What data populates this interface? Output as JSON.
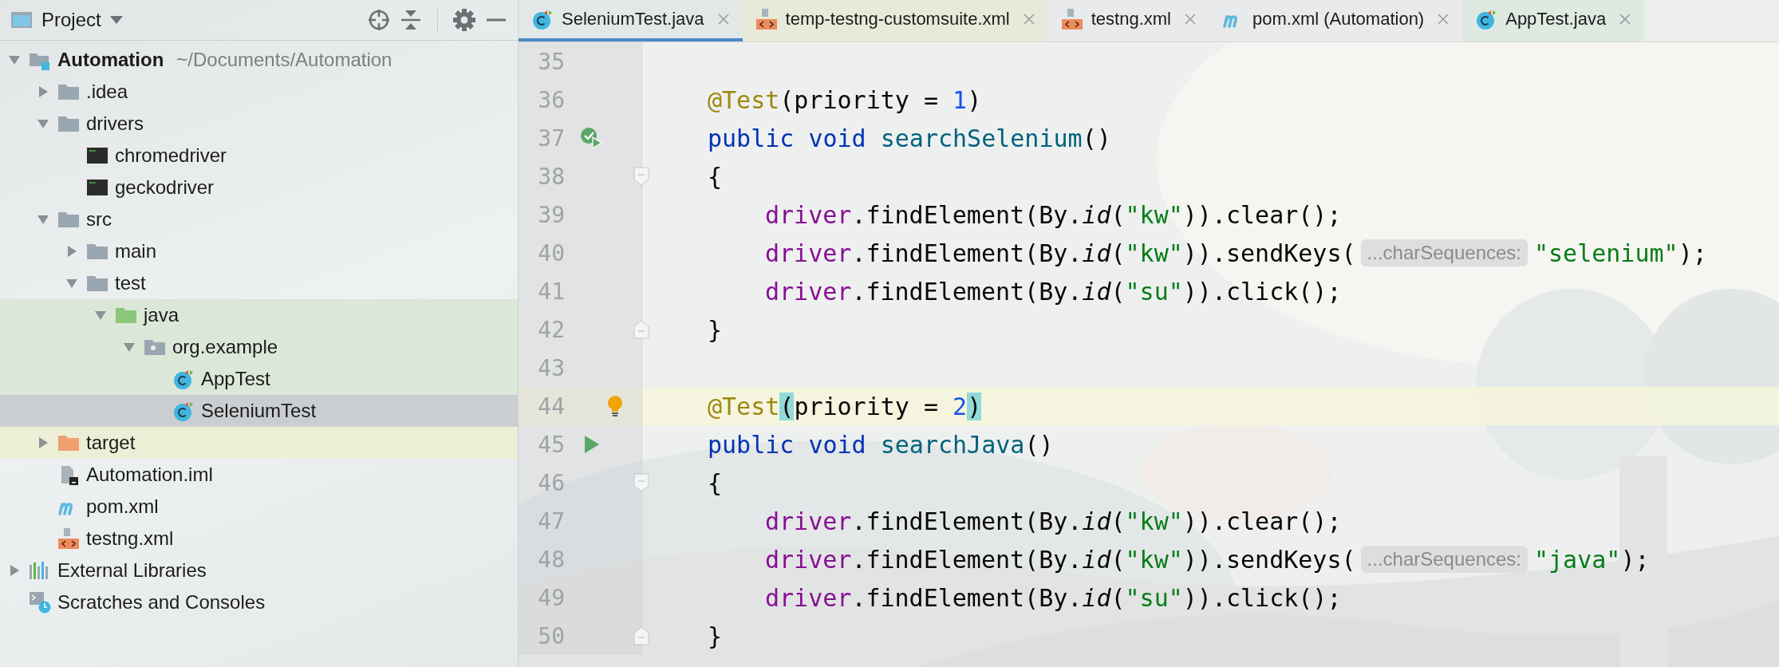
{
  "project_panel": {
    "title": "Project",
    "tree": [
      {
        "label": "Automation",
        "path": "~/Documents/Automation",
        "kind": "module",
        "expanded": true,
        "selected": false,
        "children": [
          {
            "label": ".idea",
            "kind": "folder",
            "expanded": false,
            "selected": false
          },
          {
            "label": "drivers",
            "kind": "folder",
            "expanded": true,
            "selected": false,
            "children": [
              {
                "label": "chromedriver",
                "kind": "binary",
                "selected": false
              },
              {
                "label": "geckodriver",
                "kind": "binary",
                "selected": false
              }
            ]
          },
          {
            "label": "src",
            "kind": "folder",
            "expanded": true,
            "selected": false,
            "children": [
              {
                "label": "main",
                "kind": "folder",
                "expanded": false,
                "selected": false
              },
              {
                "label": "test",
                "kind": "folder",
                "expanded": true,
                "selected": false,
                "children": [
                  {
                    "label": "java",
                    "kind": "test-folder",
                    "test_source": true,
                    "expanded": true,
                    "selected": false,
                    "children": [
                      {
                        "label": "org.example",
                        "kind": "package",
                        "test_source": true,
                        "expanded": true,
                        "selected": false,
                        "children": [
                          {
                            "label": "AppTest",
                            "kind": "test-class",
                            "test_source": true,
                            "selected": false
                          },
                          {
                            "label": "SeleniumTest",
                            "kind": "test-class",
                            "test_source": true,
                            "selected": true
                          }
                        ]
                      }
                    ]
                  }
                ]
              }
            ]
          },
          {
            "label": "target",
            "kind": "excluded-folder",
            "excluded": true,
            "expanded": false,
            "selected": false
          },
          {
            "label": "Automation.iml",
            "kind": "iml",
            "selected": false
          },
          {
            "label": "pom.xml",
            "kind": "maven",
            "selected": false
          },
          {
            "label": "testng.xml",
            "kind": "xml",
            "selected": false
          }
        ]
      },
      {
        "label": "External Libraries",
        "kind": "libraries",
        "expanded": false,
        "selected": false
      },
      {
        "label": "Scratches and Consoles",
        "kind": "scratches",
        "selected": false
      }
    ]
  },
  "editor": {
    "tabs": [
      {
        "label": "SeleniumTest.java",
        "kind": "class",
        "selected": true,
        "color": "#e2e8e8"
      },
      {
        "label": "temp-testng-customsuite.xml",
        "kind": "xml",
        "selected": false,
        "color": "#e8ead9"
      },
      {
        "label": "testng.xml",
        "kind": "xml",
        "selected": false,
        "color": "#e9eaeb"
      },
      {
        "label": "pom.xml (Automation)",
        "kind": "maven",
        "selected": false,
        "color": "#e9eaeb"
      },
      {
        "label": "AppTest.java",
        "kind": "class",
        "selected": false,
        "color": "#dde9e1"
      }
    ],
    "lines": [
      {
        "number": "35",
        "kind": "blank",
        "current": false
      },
      {
        "number": "36",
        "kind": "member",
        "current": false,
        "tokens": [
          {
            "kind": "annotation",
            "text": "@Test"
          },
          {
            "kind": "plain",
            "text": "(priority = "
          },
          {
            "kind": "number",
            "text": "1"
          },
          {
            "kind": "plain",
            "text": ")"
          }
        ]
      },
      {
        "number": "37",
        "kind": "member",
        "current": false,
        "gutter": {
          "kind": "run-passed"
        },
        "tokens": [
          {
            "kind": "keyword",
            "text": "public void "
          },
          {
            "kind": "method",
            "text": "searchSelenium"
          },
          {
            "kind": "plain",
            "text": "()"
          }
        ]
      },
      {
        "number": "38",
        "kind": "member",
        "current": false,
        "fold": {
          "kind": "start"
        },
        "tokens": [
          {
            "kind": "plain",
            "text": "{"
          }
        ]
      },
      {
        "number": "39",
        "kind": "statement",
        "current": false,
        "tokens": [
          {
            "kind": "field",
            "text": "driver"
          },
          {
            "kind": "plain",
            "text": ".findElement(By."
          },
          {
            "kind": "static",
            "text": "id"
          },
          {
            "kind": "plain",
            "text": "("
          },
          {
            "kind": "string",
            "text": "\"kw\""
          },
          {
            "kind": "plain",
            "text": ")).clear();"
          }
        ]
      },
      {
        "number": "40",
        "kind": "statement",
        "current": false,
        "tokens": [
          {
            "kind": "field",
            "text": "driver"
          },
          {
            "kind": "plain",
            "text": ".findElement(By."
          },
          {
            "kind": "static",
            "text": "id"
          },
          {
            "kind": "plain",
            "text": "("
          },
          {
            "kind": "string",
            "text": "\"kw\""
          },
          {
            "kind": "plain",
            "text": ")).sendKeys("
          },
          {
            "kind": "hint",
            "text": "...charSequences:"
          },
          {
            "kind": "string",
            "text": "\"selenium\""
          },
          {
            "kind": "plain",
            "text": ");"
          }
        ]
      },
      {
        "number": "41",
        "kind": "statement",
        "current": false,
        "tokens": [
          {
            "kind": "field",
            "text": "driver"
          },
          {
            "kind": "plain",
            "text": ".findElement(By."
          },
          {
            "kind": "static",
            "text": "id"
          },
          {
            "kind": "plain",
            "text": "("
          },
          {
            "kind": "string",
            "text": "\"su\""
          },
          {
            "kind": "plain",
            "text": ")).click();"
          }
        ]
      },
      {
        "number": "42",
        "kind": "member",
        "current": false,
        "fold": {
          "kind": "end"
        },
        "tokens": [
          {
            "kind": "plain",
            "text": "}"
          }
        ]
      },
      {
        "number": "43",
        "kind": "blank",
        "current": false
      },
      {
        "number": "44",
        "kind": "member",
        "current": true,
        "gutter": {
          "kind": "bulb"
        },
        "tokens": [
          {
            "kind": "annotation",
            "text": "@Test"
          },
          {
            "kind": "match",
            "text": "("
          },
          {
            "kind": "plain",
            "text": "priority = "
          },
          {
            "kind": "number",
            "text": "2"
          },
          {
            "kind": "match",
            "text": ")"
          }
        ]
      },
      {
        "number": "45",
        "kind": "member",
        "current": false,
        "gutter": {
          "kind": "run"
        },
        "tokens": [
          {
            "kind": "keyword",
            "text": "public void "
          },
          {
            "kind": "method",
            "text": "searchJava"
          },
          {
            "kind": "plain",
            "text": "()"
          }
        ]
      },
      {
        "number": "46",
        "kind": "member",
        "current": false,
        "fold": {
          "kind": "start"
        },
        "tokens": [
          {
            "kind": "plain",
            "text": "{"
          }
        ]
      },
      {
        "number": "47",
        "kind": "statement",
        "current": false,
        "tokens": [
          {
            "kind": "field",
            "text": "driver"
          },
          {
            "kind": "plain",
            "text": ".findElement(By."
          },
          {
            "kind": "static",
            "text": "id"
          },
          {
            "kind": "plain",
            "text": "("
          },
          {
            "kind": "string",
            "text": "\"kw\""
          },
          {
            "kind": "plain",
            "text": ")).clear();"
          }
        ]
      },
      {
        "number": "48",
        "kind": "statement",
        "current": false,
        "tokens": [
          {
            "kind": "field",
            "text": "driver"
          },
          {
            "kind": "plain",
            "text": ".findElement(By."
          },
          {
            "kind": "static",
            "text": "id"
          },
          {
            "kind": "plain",
            "text": "("
          },
          {
            "kind": "string",
            "text": "\"kw\""
          },
          {
            "kind": "plain",
            "text": ")).sendKeys("
          },
          {
            "kind": "hint",
            "text": "...charSequences:"
          },
          {
            "kind": "string",
            "text": "\"java\""
          },
          {
            "kind": "plain",
            "text": ");"
          }
        ]
      },
      {
        "number": "49",
        "kind": "statement",
        "current": false,
        "tokens": [
          {
            "kind": "field",
            "text": "driver"
          },
          {
            "kind": "plain",
            "text": ".findElement(By."
          },
          {
            "kind": "static",
            "text": "id"
          },
          {
            "kind": "plain",
            "text": "("
          },
          {
            "kind": "string",
            "text": "\"su\""
          },
          {
            "kind": "plain",
            "text": ")).click();"
          }
        ]
      },
      {
        "number": "50",
        "kind": "member",
        "current": false,
        "fold": {
          "kind": "end"
        },
        "tokens": [
          {
            "kind": "plain",
            "text": "}"
          }
        ]
      }
    ]
  }
}
